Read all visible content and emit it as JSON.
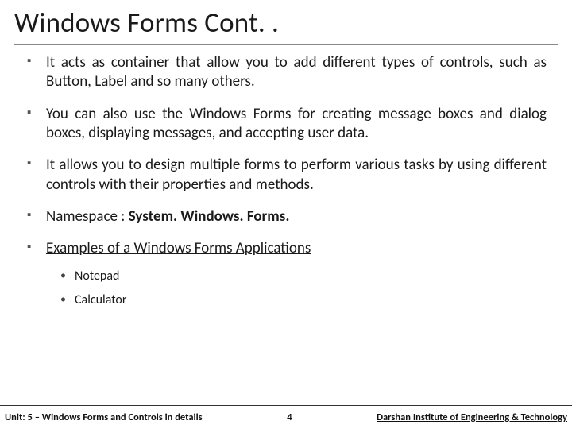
{
  "title": "Windows Forms Cont. .",
  "bullets": [
    {
      "text": "It acts as container that allow you to add different types of controls, such as Button, Label and so many others.",
      "justify": true
    },
    {
      "text": "You can also use the Windows Forms for creating message boxes and dialog boxes, displaying messages, and accepting user data.",
      "justify": true
    },
    {
      "text": "It allows you to design multiple forms to perform various tasks by using different controls with their properties and methods.",
      "justify": true
    }
  ],
  "namespace": {
    "label": "Namespace : ",
    "value": "System. Windows. Forms."
  },
  "examples": {
    "lead": "Examples of a Windows Forms Applications",
    "items": [
      "Notepad",
      "Calculator"
    ]
  },
  "footer": {
    "left": "Unit: 5 – Windows Forms and Controls in details",
    "page": "4",
    "right": "Darshan Institute of Engineering & Technology"
  }
}
